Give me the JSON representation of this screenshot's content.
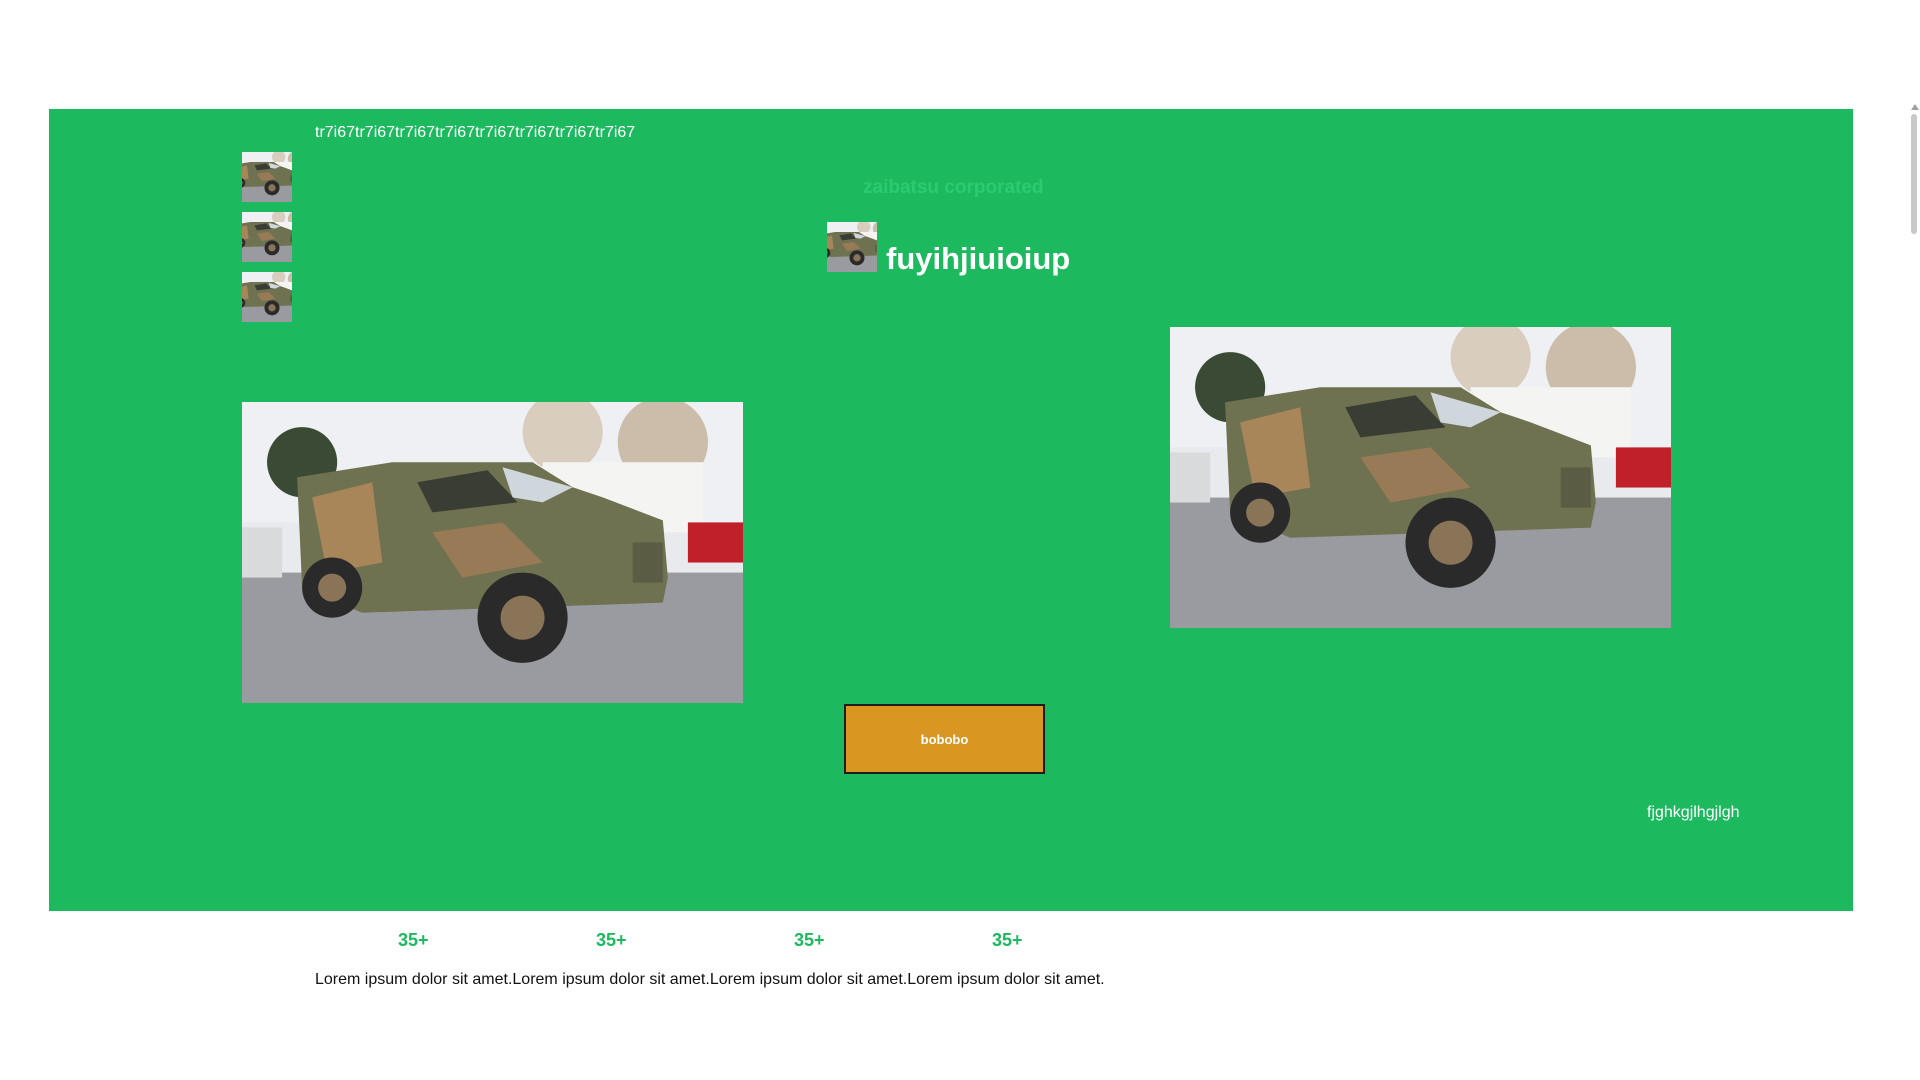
{
  "header": {
    "top_text": "tr7i67tr7i67tr7i67tr7i67tr7i67tr7i67tr7i67tr7i67",
    "corp_label": "zaibatsu corporated",
    "brand_title": "fuyihjiuioiup"
  },
  "images": {
    "thumb_icon": "jeep-photo-icon",
    "photo_subject": "military-jeep-photo"
  },
  "actions": {
    "main_button_label": "bobobo"
  },
  "footer_hero": {
    "corner_text": "fjghkgjlhgjlgh"
  },
  "stats": [
    {
      "value": "35+"
    },
    {
      "value": "35+"
    },
    {
      "value": "35+"
    },
    {
      "value": "35+"
    }
  ],
  "body": {
    "lorem": "Lorem ipsum dolor sit amet.Lorem ipsum dolor sit amet.Lorem ipsum dolor sit amet.Lorem ipsum dolor sit amet."
  },
  "colors": {
    "hero_green": "#1db95f",
    "button_orange": "#d99722",
    "stat_green": "#1db95f"
  }
}
